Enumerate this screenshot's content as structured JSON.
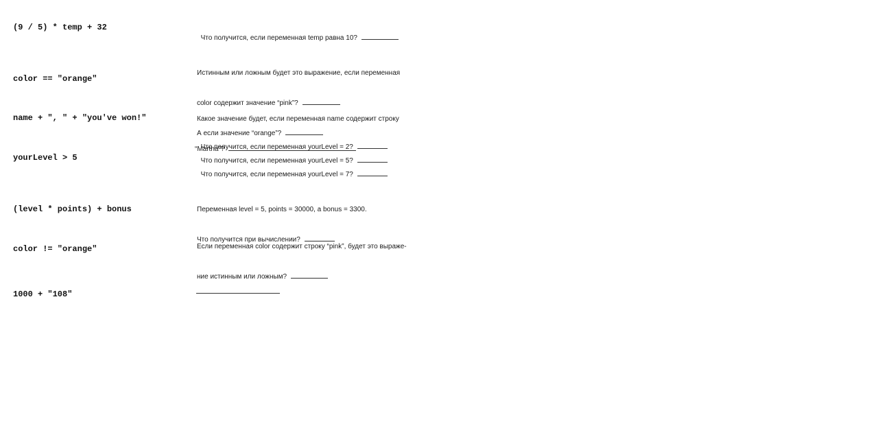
{
  "expressions": [
    "(9 / 5) * temp + 32",
    "color == \"orange\"",
    "name + \", \" + \"you've won!\"",
    "yourLevel > 5",
    "(level * points) + bonus",
    "color != \"orange\"",
    "1000 + \"108\""
  ],
  "questions": {
    "q1": "Что получится, если переменная temp равна 10?",
    "q2_line1": "Истинным или ложным будет это выражение, если переменная",
    "q2_line2": "color содержит значение “pink”?",
    "q2_line3": "А если значение “orange”?",
    "q3_line1": "Какое значение будет, если переменная name содержит строку",
    "q3_line2": "“Martha”?",
    "q4a": "Что получится, если переменная yourLevel = 2?",
    "q4b": "Что получится, если переменная yourLevel = 5?",
    "q4c": "Что получится, если переменная yourLevel = 7?",
    "q5_line1": "Переменная level = 5, points = 30000, а bonus = 3300.",
    "q5_line2": "Что получится при вычислении?",
    "q6_line1": "Если переменная color содержит строку “pink”, будет это выраже-",
    "q6_line2": "ние истинным или ложным?"
  }
}
